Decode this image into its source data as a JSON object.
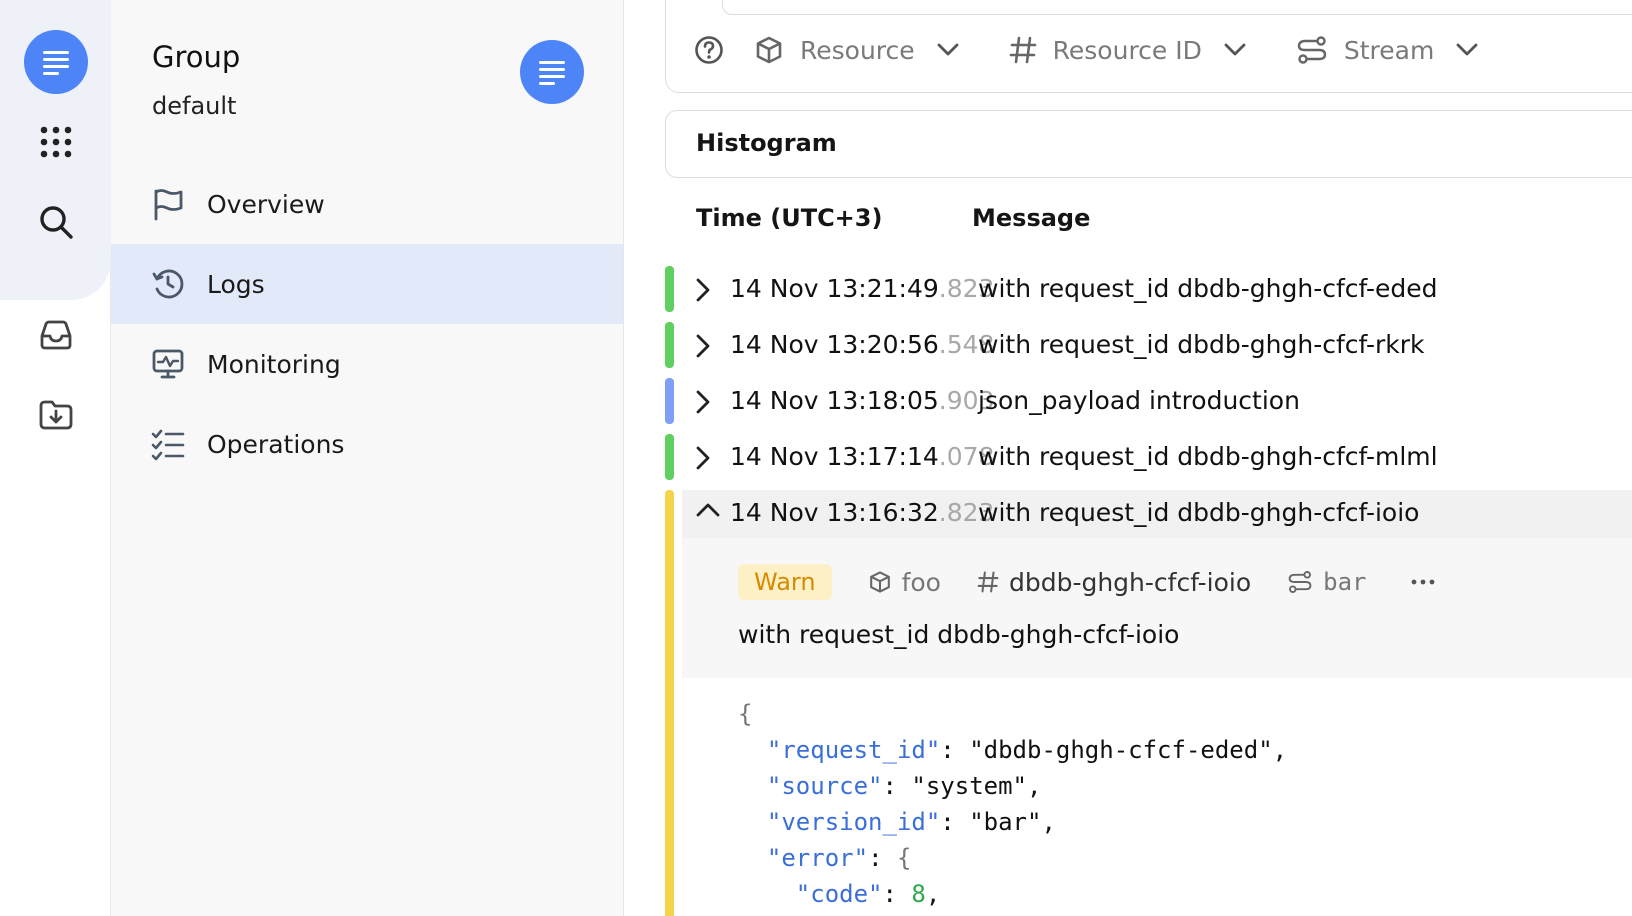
{
  "sidebar": {
    "group_title": "Group",
    "group_name": "default",
    "items": [
      {
        "label": "Overview",
        "icon": "flag-icon",
        "active": false
      },
      {
        "label": "Logs",
        "icon": "history-icon",
        "active": true
      },
      {
        "label": "Monitoring",
        "icon": "monitor-icon",
        "active": false
      },
      {
        "label": "Operations",
        "icon": "checklist-icon",
        "active": false
      }
    ]
  },
  "filters": {
    "resource": "Resource",
    "resource_id": "Resource ID",
    "stream": "Stream"
  },
  "histogram": {
    "title": "Histogram"
  },
  "columns": {
    "time": "Time (UTC+3)",
    "message": "Message"
  },
  "logs": [
    {
      "time": "14 Nov 13:21:49",
      "ms": ".823",
      "message": "with request_id dbdb-ghgh-cfcf-eded",
      "level_color": "#5fcf5f"
    },
    {
      "time": "14 Nov 13:20:56",
      "ms": ".548",
      "message": "with request_id dbdb-ghgh-cfcf-rkrk",
      "level_color": "#5fcf5f"
    },
    {
      "time": "14 Nov 13:18:05",
      "ms": ".903",
      "message": "json_payload introduction",
      "level_color": "#7f9ef5"
    },
    {
      "time": "14 Nov 13:17:14",
      "ms": ".078",
      "message": "with request_id dbdb-ghgh-cfcf-mlml",
      "level_color": "#5fcf5f"
    }
  ],
  "expanded": {
    "time": "14 Nov 13:16:32",
    "ms": ".823",
    "message": "with request_id dbdb-ghgh-cfcf-ioio",
    "level": "Warn",
    "level_color": "#f6d34a",
    "resource": "foo",
    "resource_id": "dbdb-ghgh-cfcf-ioio",
    "stream": "bar",
    "more": "···",
    "detail": "with request_id dbdb-ghgh-cfcf-ioio",
    "json": {
      "open": "{",
      "request_id_key": "\"request_id\"",
      "request_id_val": "\"dbdb-ghgh-cfcf-eded\",",
      "source_key": "\"source\"",
      "source_val": "\"system\",",
      "version_key": "\"version_id\"",
      "version_val": "\"bar\",",
      "error_key": "\"error\"",
      "error_val": "{",
      "code_key": "\"code\"",
      "code_val": "8",
      "code_tail": ","
    }
  },
  "colors": {
    "accent": "#4d84f7",
    "active_nav": "#e2e9f8",
    "warn_bg": "#fdf0c6",
    "warn_text": "#d68a00"
  }
}
